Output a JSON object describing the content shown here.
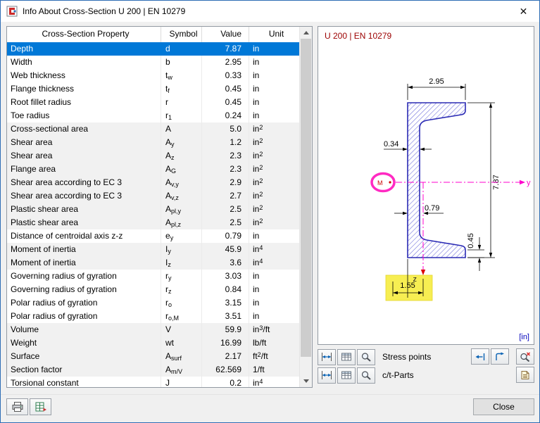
{
  "window": {
    "title": "Info About Cross-Section U 200 | EN 10279",
    "close_glyph": "✕"
  },
  "table": {
    "headers": [
      "Cross-Section Property",
      "Symbol",
      "Value",
      "Unit"
    ],
    "rows": [
      {
        "p": "Depth",
        "s": "d",
        "v": "7.87",
        "u": "in",
        "sel": true
      },
      {
        "p": "Width",
        "s": "b",
        "v": "2.95",
        "u": "in"
      },
      {
        "p": "Web thickness",
        "s": "t_w",
        "v": "0.33",
        "u": "in"
      },
      {
        "p": "Flange thickness",
        "s": "t_f",
        "v": "0.45",
        "u": "in"
      },
      {
        "p": "Root fillet radius",
        "s": "r",
        "v": "0.45",
        "u": "in"
      },
      {
        "p": "Toe radius",
        "s": "r_1",
        "v": "0.24",
        "u": "in"
      },
      {
        "p": "Cross-sectional area",
        "s": "A",
        "v": "5.0",
        "u": "in^2",
        "shade": true
      },
      {
        "p": "Shear area",
        "s": "A_y",
        "v": "1.2",
        "u": "in^2",
        "shade": true
      },
      {
        "p": "Shear area",
        "s": "A_z",
        "v": "2.3",
        "u": "in^2",
        "shade": true
      },
      {
        "p": "Flange area",
        "s": "A_G",
        "v": "2.3",
        "u": "in^2",
        "shade": true
      },
      {
        "p": "Shear area according to EC 3",
        "s": "A_v,y",
        "v": "2.9",
        "u": "in^2",
        "shade": true
      },
      {
        "p": "Shear area according to EC 3",
        "s": "A_v,z",
        "v": "2.7",
        "u": "in^2",
        "shade": true
      },
      {
        "p": "Plastic shear area",
        "s": "A_pl,y",
        "v": "2.5",
        "u": "in^2",
        "shade": true
      },
      {
        "p": "Plastic shear area",
        "s": "A_pl,z",
        "v": "2.5",
        "u": "in^2",
        "shade": true
      },
      {
        "p": "Distance of centroidal axis z-z",
        "s": "e_y",
        "v": "0.79",
        "u": "in"
      },
      {
        "p": "Moment of inertia",
        "s": "I_y",
        "v": "45.9",
        "u": "in^4",
        "shade": true
      },
      {
        "p": "Moment of inertia",
        "s": "I_z",
        "v": "3.6",
        "u": "in^4",
        "shade": true
      },
      {
        "p": "Governing radius of gyration",
        "s": "r_y",
        "v": "3.03",
        "u": "in"
      },
      {
        "p": "Governing radius of gyration",
        "s": "r_z",
        "v": "0.84",
        "u": "in"
      },
      {
        "p": "Polar radius of gyration",
        "s": "r_o",
        "v": "3.15",
        "u": "in"
      },
      {
        "p": "Polar radius of gyration",
        "s": "r_o,M",
        "v": "3.51",
        "u": "in"
      },
      {
        "p": "Volume",
        "s": "V",
        "v": "59.9",
        "u": "in^3/ft",
        "shade": true
      },
      {
        "p": "Weight",
        "s": "wt",
        "v": "16.99",
        "u": "lb/ft",
        "shade": true
      },
      {
        "p": "Surface",
        "s": "A_surf",
        "v": "2.17",
        "u": "ft^2/ft",
        "shade": true
      },
      {
        "p": "Section factor",
        "s": "A_m/V",
        "v": "62.569",
        "u": "1/ft",
        "shade": true
      },
      {
        "p": "Torsional constant",
        "s": "J",
        "v": "0.2",
        "u": "in^4"
      }
    ]
  },
  "drawing": {
    "caption": "U 200 | EN 10279",
    "dims": {
      "width": "2.95",
      "web_thickness": "0.34",
      "depth": "7.87",
      "centroid_distance": "0.79",
      "flange_thickness": "0.45",
      "shear_center_distance": "1.55"
    },
    "labels": {
      "axis_y": "y",
      "axis_z": "z",
      "shear_center": "M",
      "units": "[in]"
    }
  },
  "toolbars": {
    "stress_points_label": "Stress points",
    "ct_parts_label": "c/t-Parts"
  },
  "footer": {
    "close_label": "Close"
  },
  "icons": {
    "dialog-icon": "cross-section glyph",
    "close-icon": "✕",
    "dimension-icon": "double arrow with extension bars",
    "table-icon": "grid",
    "zoom-icon": "magnifier",
    "zoom-reset-icon": "magnifier with red x",
    "flip-arrow-icon": "blue arrow to bar",
    "rotate-arrow-icon": "blue corner arrow",
    "manual-icon": "document pages",
    "print-icon": "printer",
    "export-icon": "spreadsheet with red arrow",
    "scroll-up-icon": "▲",
    "scroll-down-icon": "▼"
  },
  "colors": {
    "selection": "#0078d7",
    "highlight": "#f7ee52",
    "axis": "#ff00cc",
    "section_outline": "#2b2bb4",
    "caption": "#9c0000"
  }
}
